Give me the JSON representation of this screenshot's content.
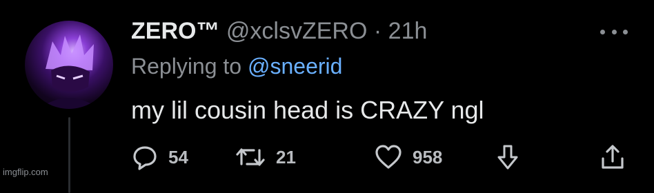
{
  "tweet": {
    "display_name": "ZERO™",
    "handle": "@xclsvZERO",
    "separator": "·",
    "time": "21h",
    "replying_prefix": "Replying to",
    "replying_to": "@sneerid",
    "text": "my lil cousin head is CRAZY ngl"
  },
  "actions": {
    "reply_count": "54",
    "retweet_count": "21",
    "like_count": "958"
  },
  "icons": {
    "more": "more-dots-icon",
    "reply": "reply-bubble-icon",
    "retweet": "retweet-icon",
    "like": "heart-icon",
    "downvote": "down-arrow-icon",
    "share": "share-icon"
  },
  "watermark": "imgflip.com",
  "colors": {
    "background": "#000000",
    "text": "#e7e9ea",
    "muted": "#8b8f94",
    "mention": "#6ab0ff",
    "avatar_accent": "#8a3fd6"
  }
}
